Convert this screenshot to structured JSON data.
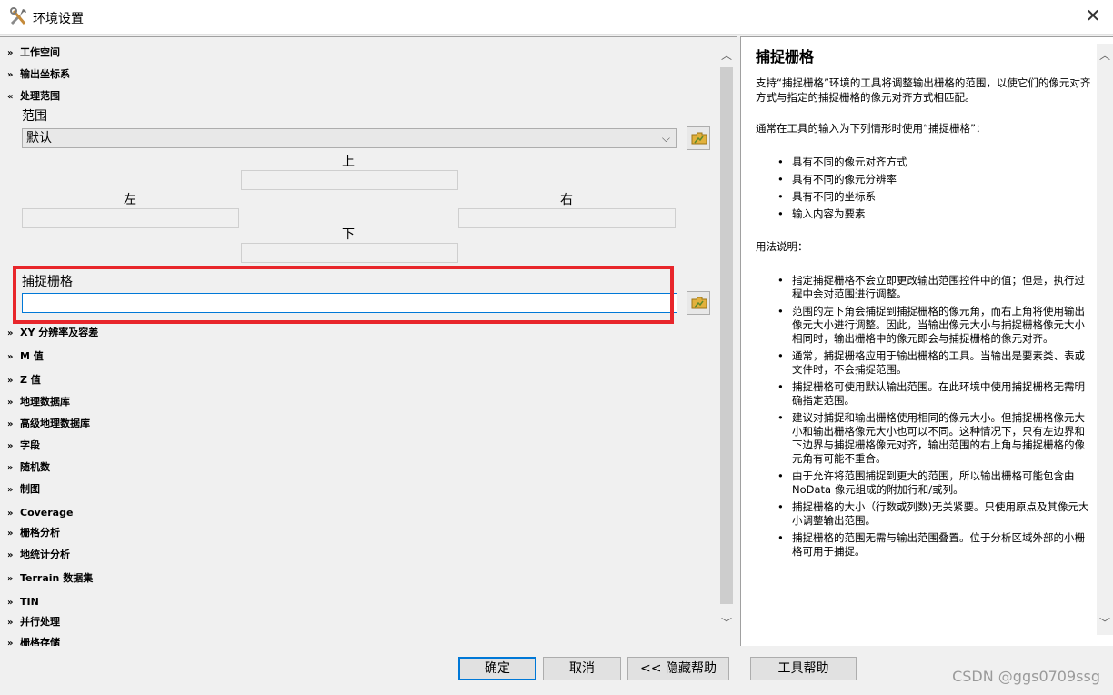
{
  "window": {
    "title": "环境设置",
    "close_glyph": "✕"
  },
  "sections_top": [
    {
      "label": "工作空间",
      "chevron": "»"
    },
    {
      "label": "输出坐标系",
      "chevron": "»"
    },
    {
      "label": "处理范围",
      "chevron": "«"
    }
  ],
  "extent": {
    "label": "范围",
    "dropdown_value": "默认",
    "top_label": "上",
    "left_label": "左",
    "right_label": "右",
    "bottom_label": "下"
  },
  "snap": {
    "label": "捕捉栅格",
    "value": ""
  },
  "sections_bottom": [
    {
      "label": "XY 分辨率及容差"
    },
    {
      "label": "M 值"
    },
    {
      "label": "Z 值"
    },
    {
      "label": "地理数据库"
    },
    {
      "label": "高级地理数据库"
    },
    {
      "label": "字段"
    },
    {
      "label": "随机数"
    },
    {
      "label": "制图"
    },
    {
      "label": "Coverage"
    },
    {
      "label": "栅格分析"
    },
    {
      "label": "地统计分析"
    },
    {
      "label": "Terrain 数据集"
    },
    {
      "label": "TIN"
    },
    {
      "label": "并行处理"
    },
    {
      "label": "栅格存储"
    }
  ],
  "help": {
    "title": "捕捉栅格",
    "intro": "支持“捕捉栅格”环境的工具将调整输出栅格的范围，以使它们的像元对齐方式与指定的捕捉栅格的像元对齐方式相匹配。",
    "usage_intro": "通常在工具的输入为下列情形时使用“捕捉栅格”：",
    "usage_items": [
      "具有不同的像元对齐方式",
      "具有不同的像元分辨率",
      "具有不同的坐标系",
      "输入内容为要素"
    ],
    "notes_title": "用法说明：",
    "notes": [
      "指定捕捉栅格不会立即更改输出范围控件中的值；但是，执行过程中会对范围进行调整。",
      "范围的左下角会捕捉到捕捉栅格的像元角，而右上角将使用输出像元大小进行调整。因此，当输出像元大小与捕捉栅格像元大小相同时，输出栅格中的像元即会与捕捉栅格的像元对齐。",
      "通常，捕捉栅格应用于输出栅格的工具。当输出是要素类、表或文件时，不会捕捉范围。",
      "捕捉栅格可使用默认输出范围。在此环境中使用捕捉栅格无需明确指定范围。",
      "建议对捕捉和输出栅格使用相同的像元大小。但捕捉栅格像元大小和输出栅格像元大小也可以不同。这种情况下，只有左边界和下边界与捕捉栅格像元对齐，输出范围的右上角与捕捉栅格的像元角有可能不重合。",
      "由于允许将范围捕捉到更大的范围，所以输出栅格可能包含由 NoData 像元组成的附加行和/或列。",
      "捕捉栅格的大小（行数或列数)无关紧要。只使用原点及其像元大小调整输出范围。",
      "捕捉栅格的范围无需与输出范围叠置。位于分析区域外部的小栅格可用于捕捉。"
    ]
  },
  "footer": {
    "ok": "确定",
    "cancel": "取消",
    "hide_help": "<< 隐藏帮助",
    "tool_help": "工具帮助",
    "watermark": "CSDN @ggs0709ssg"
  },
  "colors": {
    "highlight": "#e8262b",
    "focus": "#0078d7"
  }
}
